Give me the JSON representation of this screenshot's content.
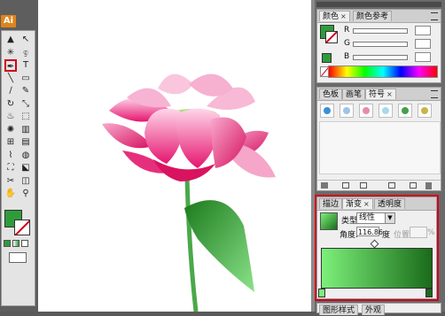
{
  "app": {
    "logo_text": "Ai"
  },
  "tools": [
    {
      "name": "selection-tool",
      "glyph": "▲"
    },
    {
      "name": "direct-selection-tool",
      "glyph": "↖"
    },
    {
      "name": "magic-wand-tool",
      "glyph": "✳"
    },
    {
      "name": "lasso-tool",
      "glyph": "ඉ"
    },
    {
      "name": "pen-tool",
      "glyph": "✒"
    },
    {
      "name": "type-tool",
      "glyph": "T"
    },
    {
      "name": "line-tool",
      "glyph": "╲"
    },
    {
      "name": "rectangle-tool",
      "glyph": "▭"
    },
    {
      "name": "paintbrush-tool",
      "glyph": "∕"
    },
    {
      "name": "pencil-tool",
      "glyph": "✎"
    },
    {
      "name": "rotate-tool",
      "glyph": "↻"
    },
    {
      "name": "scale-tool",
      "glyph": "⤡"
    },
    {
      "name": "warp-tool",
      "glyph": "♨"
    },
    {
      "name": "free-transform-tool",
      "glyph": "⬚"
    },
    {
      "name": "symbol-sprayer-tool",
      "glyph": "✺"
    },
    {
      "name": "graph-tool",
      "glyph": "▥"
    },
    {
      "name": "mesh-tool",
      "glyph": "⊞"
    },
    {
      "name": "gradient-tool",
      "glyph": "▤"
    },
    {
      "name": "eyedropper-tool",
      "glyph": "⌇"
    },
    {
      "name": "blend-tool",
      "glyph": "◍"
    },
    {
      "name": "live-paint-tool",
      "glyph": "⛶"
    },
    {
      "name": "live-paint-selection-tool",
      "glyph": "⬕"
    },
    {
      "name": "slice-tool",
      "glyph": "✂"
    },
    {
      "name": "eraser-tool",
      "glyph": "◫"
    },
    {
      "name": "hand-tool",
      "glyph": "✋"
    },
    {
      "name": "zoom-tool",
      "glyph": "⚲"
    }
  ],
  "color_panel": {
    "tabs": [
      "颜色",
      "颜色参考"
    ],
    "close": "×",
    "channels": [
      "R",
      "G",
      "B"
    ],
    "colors": {
      "fill": "#2f9c3a",
      "stroke_indicator": "#d0021b"
    }
  },
  "swatches_panel": {
    "tabs": [
      "色板",
      "画笔",
      "符号"
    ],
    "close": "×",
    "symbols": [
      {
        "name": "bird-symbol-icon",
        "color": "#3b8fd6"
      },
      {
        "name": "cloud-symbol-icon",
        "color": "#9cc4e8"
      },
      {
        "name": "flower-symbol-icon",
        "color": "#e58bb0"
      },
      {
        "name": "bubble-symbol-icon",
        "color": "#a9d8ef"
      },
      {
        "name": "tree-symbol-icon",
        "color": "#43a047"
      },
      {
        "name": "grass-symbol-icon",
        "color": "#c9b54a"
      }
    ]
  },
  "gradient_panel": {
    "tabs": [
      "描边",
      "渐变",
      "透明度"
    ],
    "close": "×",
    "type_label": "类型:",
    "type_value": "线性",
    "angle_label": "角度:",
    "angle_value": "116.86",
    "angle_unit": "度",
    "position_label": "位置",
    "position_unit": "%",
    "colors": {
      "stop_left": "#7cf07a",
      "stop_right": "#1a6b1a"
    }
  },
  "bottom_panel": {
    "tabs": [
      "图形样式",
      "外观"
    ]
  }
}
